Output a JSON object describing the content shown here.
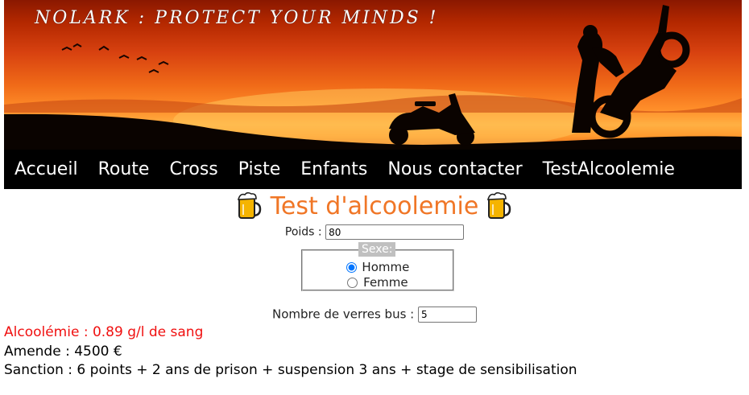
{
  "banner": {
    "title": "NOLARK : PROTECT YOUR MINDS !"
  },
  "nav": {
    "items": [
      {
        "label": "Accueil"
      },
      {
        "label": "Route"
      },
      {
        "label": "Cross"
      },
      {
        "label": "Piste"
      },
      {
        "label": "Enfants"
      },
      {
        "label": "Nous contacter"
      },
      {
        "label": "TestAlcoolemie"
      }
    ]
  },
  "form": {
    "title": "Test d'alcoolemie",
    "poids_label": "Poids :",
    "poids_value": "80",
    "sexe_legend": "Sexe:",
    "sexe_options": [
      {
        "label": "Homme",
        "checked": true
      },
      {
        "label": "Femme",
        "checked": false
      }
    ],
    "verres_label": "Nombre de verres bus :",
    "verres_value": "5"
  },
  "results": {
    "alcoolemie": "Alcoolémie : 0.89 g/l de sang",
    "amende": "Amende : 4500 €",
    "sanction": "Sanction : 6 points + 2 ans de prison + suspension 3 ans + stage de sensibilisation"
  },
  "colors": {
    "title_orange": "#f07626",
    "alert_red": "#f01010",
    "nav_bg": "#000000"
  }
}
